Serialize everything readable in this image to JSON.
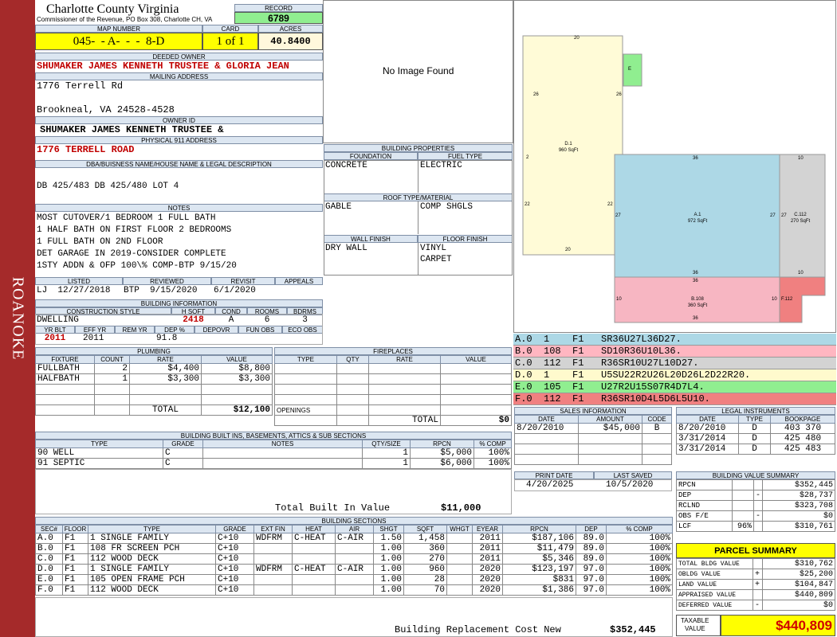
{
  "sidebar": {
    "label": "ROANOKE"
  },
  "header": {
    "county": "Charlotte County Virginia",
    "sub": "Commissioner of the Revenue, PO Box 308, Charlotte CH, VA",
    "record_label": "RECORD",
    "record": "6789",
    "map_label": "MAP NUMBER",
    "map": "045-  - A-  -  -  8-D",
    "card_label": "CARD",
    "card": "1 of 1",
    "acres_label": "ACRES",
    "acres": "40.8400"
  },
  "owner": {
    "deeded_label": "DEEDED OWNER",
    "deeded": "SHUMAKER JAMES KENNETH TRUSTEE & GLORIA JEAN",
    "mailing_label": "MAILING ADDRESS",
    "addr1": "1776 Terrell Rd",
    "addr2": "Brookneal, VA 24528-4528",
    "id_label": "OWNER ID",
    "id": "SHUMAKER JAMES KENNETH TRUSTEE &",
    "phys_label": "PHYSICAL 911 ADDRESS",
    "phys": "1776 TERRELL ROAD"
  },
  "legal": {
    "label": "DBA/BUISNESS NAME/HOUSE NAME & LEGAL DESCRIPTION",
    "text": "DB 425/483 DB 425/480 LOT 4"
  },
  "notes": {
    "label": "NOTES",
    "lines": [
      "MOST CUTOVER/1 BEDROOM 1 FULL BATH",
      "1 HALF BATH ON FIRST FLOOR 2 BEDROOMS",
      "1 FULL BATH ON 2ND FLOOR",
      "DET GARAGE IN 2019-CONSIDER COMPLETE",
      "1STY ADDN & OFP 100\\% COMP-BTP 9/15/20"
    ]
  },
  "dates": {
    "listed_label": "LISTED",
    "listed": "LJ  12/27/2018",
    "reviewed_label": "REVIEWED",
    "reviewed": "BTP  9/15/2020",
    "revisit_label": "REVISIT",
    "revisit": "6/1/2020",
    "appeals_label": "APPEALS"
  },
  "bldg_info": {
    "label": "BUILDING INFORMATION",
    "cols": [
      "CONSTRUCTION STYLE",
      "H SQFT",
      "COND",
      "ROOMS",
      "BDRMS"
    ],
    "style": "DWELLING",
    "hsqft": "2418",
    "cond": "A",
    "rooms": "6",
    "bdrms": "3",
    "cols2": [
      "YR BLT",
      "EFF YR",
      "REM YR",
      "DEP %",
      "DEPOVR",
      "FUN OBS",
      "ECO OBS"
    ],
    "yrblt": "2011",
    "effyr": "2011",
    "dep": "91.8"
  },
  "photo": {
    "text": "No Image Found"
  },
  "bprops": {
    "label": "BUILDING PROPERTIES",
    "foundation_label": "FOUNDATION",
    "foundation": "CONCRETE",
    "fuel_label": "FUEL TYPE",
    "fuel": "ELECTRIC",
    "roof_label": "ROOF TYPE/MATERIAL",
    "roof1": "GABLE",
    "roof2": "COMP SHGLS",
    "wall_label": "WALL FINISH",
    "wall": "DRY WALL",
    "floor_label": "FLOOR FINISH",
    "floor1": "VINYL",
    "floor2": "CARPET"
  },
  "plumbing": {
    "label": "PLUMBING",
    "cols": [
      "FIXTURE",
      "COUNT",
      "RATE",
      "VALUE"
    ],
    "rows": [
      [
        "FULLBATH",
        "2",
        "$4,400",
        "$8,800"
      ],
      [
        "HALFBATH",
        "1",
        "$3,300",
        "$3,300"
      ]
    ],
    "total_label": "TOTAL",
    "total": "$12,100"
  },
  "fireplaces": {
    "label": "FIREPLACES",
    "cols": [
      "TYPE",
      "QTY",
      "RATE",
      "VALUE"
    ],
    "openings": "OPENINGS",
    "total_label": "TOTAL",
    "total": "$0"
  },
  "builtins": {
    "label": "BUILDING BUILT INS, BASEMENTS, ATTICS & SUB SECTIONS",
    "cols": [
      "TYPE",
      "GRADE",
      "NOTES",
      "QTY/SIZE",
      "RPCN",
      "% COMP"
    ],
    "rows": [
      [
        "90 WELL",
        "C",
        "",
        "1",
        "$5,000",
        "100%"
      ],
      [
        "91 SEPTIC",
        "C",
        "",
        "1",
        "$6,000",
        "100%"
      ]
    ],
    "total_label": "Total Built In Value",
    "total": "$11,000"
  },
  "sections": {
    "label": "BUILDING SECTIONS",
    "cols": [
      "SEC#",
      "FLOOR",
      "TYPE",
      "GRADE",
      "EXT FIN",
      "HEAT",
      "AIR",
      "SHGT",
      "SQFT",
      "WHGT",
      "EYEAR",
      "RPCN",
      "DEP",
      "% COMP"
    ],
    "rows": [
      [
        "A.0",
        "F1",
        "1 SINGLE FAMILY",
        "C+10",
        "WDFRM",
        "C-HEAT",
        "C-AIR",
        "1.50",
        "1,458",
        "",
        "2011",
        "$187,106",
        "89.0",
        "100%"
      ],
      [
        "B.0",
        "F1",
        "108 FR SCREEN PCH",
        "C+10",
        "",
        "",
        "",
        "1.00",
        "360",
        "",
        "2011",
        "$11,479",
        "89.0",
        "100%"
      ],
      [
        "C.0",
        "F1",
        "112 WOOD DECK",
        "C+10",
        "",
        "",
        "",
        "1.00",
        "270",
        "",
        "2011",
        "$5,346",
        "89.0",
        "100%"
      ],
      [
        "D.0",
        "F1",
        "1 SINGLE FAMILY",
        "C+10",
        "WDFRM",
        "C-HEAT",
        "C-AIR",
        "1.00",
        "960",
        "",
        "2020",
        "$123,197",
        "97.0",
        "100%"
      ],
      [
        "E.0",
        "F1",
        "105 OPEN FRAME PCH",
        "C+10",
        "",
        "",
        "",
        "1.00",
        "28",
        "",
        "2020",
        "$831",
        "97.0",
        "100%"
      ],
      [
        "F.0",
        "F1",
        "112 WOOD DECK",
        "C+10",
        "",
        "",
        "",
        "1.00",
        "70",
        "",
        "2020",
        "$1,386",
        "97.0",
        "100%"
      ]
    ],
    "total_label": "Building Replacement Cost New",
    "total": "$352,445"
  },
  "sketch": {
    "labels": {
      "d": "D.1",
      "d_sq": "960 SqFt",
      "a": "A.1",
      "a_sq": "972 SqFt",
      "c": "C.112",
      "c_sq": "270 SqFt",
      "b": "B.108",
      "b_sq": "360 SqFt",
      "e": "E",
      "f": "F.112"
    },
    "dims": {
      "d_top": "20",
      "d_left": "26",
      "d_right": "26",
      "d_l2": "2",
      "d_l22": "22",
      "d_r22": "22",
      "d_bot": "20",
      "a_top": "36",
      "a_l": "27",
      "a_r": "27",
      "c_top": "10",
      "c_r": "27",
      "c_bot": "10",
      "a_bot": "36",
      "b_top": "36",
      "b_l": "10",
      "b_r": "10",
      "b_bot": "36"
    },
    "colors": {
      "d": "#fffbd7",
      "a": "#add8e6",
      "c": "#d3d3d3",
      "b": "#f7b6c2",
      "e": "#90ee90",
      "f": "#f08080"
    }
  },
  "sketch_codes": [
    {
      "text": "A.0  1    F1   SR36U27L36D27.",
      "color": "#add8e6"
    },
    {
      "text": "B.0  108  F1   SD10R36U10L36.",
      "color": "#ffb6c1"
    },
    {
      "text": "C.0  112  F1   R36SR10U27L10D27.",
      "color": "#d3d3d3"
    },
    {
      "text": "D.0  1    F1   U5SU22R2U26L20D26L2D22R20.",
      "color": "#fffacd"
    },
    {
      "text": "E.0  105  F1   U27R2U15S07R4D7L4.",
      "color": "#90ee90"
    },
    {
      "text": "F.0  112  F1   R36SR10D4L5D6L5U10.",
      "color": "#f08080"
    }
  ],
  "sales": {
    "label": "SALES INFORMATION",
    "cols": [
      "DATE",
      "AMOUNT",
      "CODE"
    ],
    "rows": [
      [
        "8/20/2010",
        "$45,000",
        "B"
      ]
    ]
  },
  "legal_inst": {
    "label": "LEGAL INSTRUMENTS",
    "cols": [
      "DATE",
      "TYPE",
      "BOOKPAGE"
    ],
    "rows": [
      [
        "8/20/2010",
        "D",
        "403 370"
      ],
      [
        "3/31/2014",
        "D",
        "425 480"
      ],
      [
        "3/31/2014",
        "D",
        "425 483"
      ]
    ]
  },
  "print": {
    "print_label": "PRINT DATE",
    "print": "4/20/2025",
    "saved_label": "LAST SAVED",
    "saved": "10/5/2020"
  },
  "bvs": {
    "label": "BUILDING VALUE SUMMARY",
    "rows": [
      [
        "RPCN",
        "",
        "",
        "$352,445"
      ],
      [
        "DEP",
        "",
        "-",
        "$28,737"
      ],
      [
        "RCLND",
        "",
        "",
        "$323,708"
      ],
      [
        "OBS F/E",
        "",
        "-",
        "$0"
      ],
      [
        "LCF",
        "96%",
        "",
        "$310,761"
      ]
    ]
  },
  "parcel": {
    "label": "PARCEL SUMMARY",
    "rows": [
      [
        "TOTAL BLDG VALUE",
        "",
        "$310,762"
      ],
      [
        "OBLDG VALUE",
        "+",
        "$25,200"
      ],
      [
        "LAND VALUE",
        "+",
        "$104,847"
      ],
      [
        "APPRAISED VALUE",
        "",
        "$440,809"
      ],
      [
        "DEFERRED VALUE",
        "-",
        "$0"
      ]
    ],
    "taxable_label1": "TAXABLE",
    "taxable_label2": "VALUE",
    "taxable": "$440,809"
  }
}
